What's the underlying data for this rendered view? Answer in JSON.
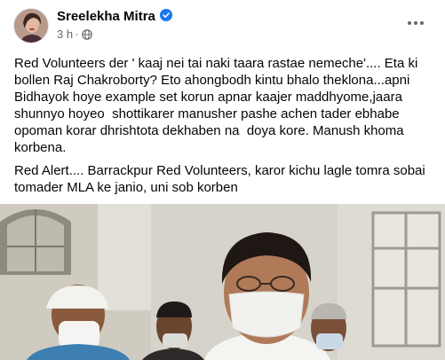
{
  "post": {
    "author_name": "Sreelekha Mitra",
    "time": "3 h",
    "dot": "·",
    "text_paragraphs": [
      "Red Volunteers der ' kaaj nei tai naki taara rastae nemeche'.... Eta ki bollen Raj Chakroborty? Eto ahongbodh kintu bhalo theklona...apni Bidhayok hoye example set korun apnar kaajer maddhyome,jaara shunnyo hoyeo  shottikarer manusher pashe achen tader ebhabe opoman korar dhrishtota dekhaben na  doya kore. Manush khoma korbena.",
      "Red Alert.... Barrackpur Red Volunteers, karor kichu lagle tomra sobai tomader MLA ke janio, uni sob korben"
    ]
  },
  "icons": {
    "verified": "verified-badge-icon",
    "audience": "globe-icon",
    "more": "more-options-icon"
  },
  "colors": {
    "verified_blue": "#1877f2",
    "meta_gray": "#65676b",
    "text": "#050505"
  }
}
